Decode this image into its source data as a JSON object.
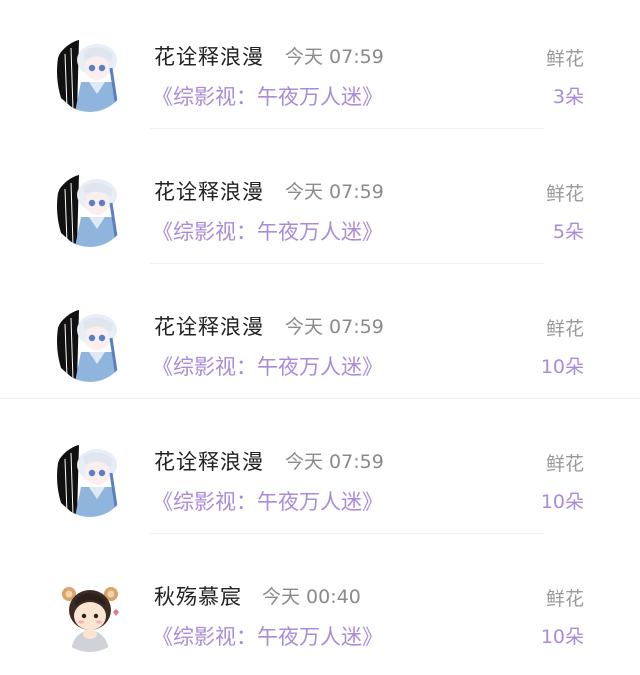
{
  "gifts": [
    {
      "name": "花诠释浪漫",
      "time": "今天 07:59",
      "book": "《综影视：午夜万人迷》",
      "gift_type": "鲜花",
      "count": "3朵",
      "avatar_icon": "anime-girl-avatar"
    },
    {
      "name": "花诠释浪漫",
      "time": "今天 07:59",
      "book": "《综影视：午夜万人迷》",
      "gift_type": "鲜花",
      "count": "5朵",
      "avatar_icon": "anime-girl-avatar"
    },
    {
      "name": "花诠释浪漫",
      "time": "今天 07:59",
      "book": "《综影视：午夜万人迷》",
      "gift_type": "鲜花",
      "count": "10朵",
      "avatar_icon": "anime-girl-avatar"
    },
    {
      "name": "花诠释浪漫",
      "time": "今天 07:59",
      "book": "《综影视：午夜万人迷》",
      "gift_type": "鲜花",
      "count": "10朵",
      "avatar_icon": "anime-girl-avatar"
    },
    {
      "name": "秋殇慕宸",
      "time": "今天 00:40",
      "book": "《综影视：午夜万人迷》",
      "gift_type": "鲜花",
      "count": "10朵",
      "avatar_icon": "chibi-boy-avatar"
    }
  ],
  "colors": {
    "accent_purple": "#a98bd8",
    "name_text": "#222222",
    "muted_text": "#8a8a8a"
  }
}
